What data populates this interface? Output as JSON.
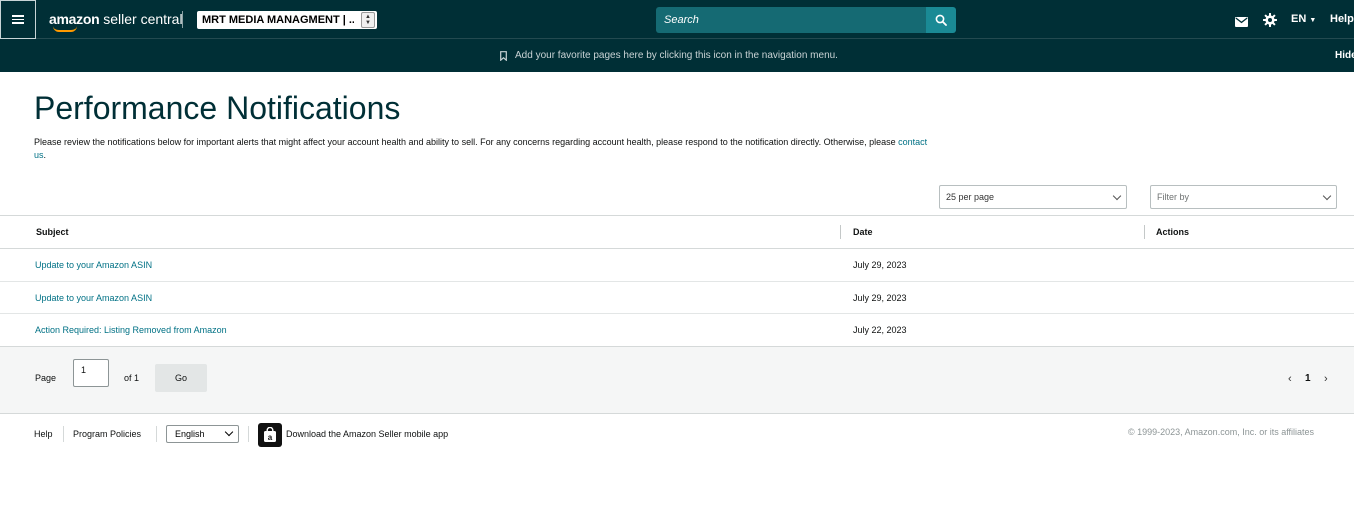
{
  "topbar": {
    "logo_brand": "amazon",
    "logo_sub": " seller central",
    "account": "MRT MEDIA MANAGMENT | ...",
    "search_placeholder": "Search",
    "language": "EN",
    "help": "Help"
  },
  "favorites_bar": {
    "message": "Add your favorite pages here by clicking this icon in the navigation menu.",
    "hide": "Hide"
  },
  "page": {
    "title": "Performance Notifications",
    "intro_text": "Please review the notifications below for important alerts that might affect your account health and ability to sell. For any concerns regarding account health, please respond to the notification directly. Otherwise, please ",
    "intro_link": "contact us",
    "intro_end": "."
  },
  "controls": {
    "per_page": "25 per page",
    "filter_placeholder": "Filter by"
  },
  "table": {
    "headers": {
      "subject": "Subject",
      "date": "Date",
      "actions": "Actions"
    },
    "rows": [
      {
        "subject": "Update to your Amazon ASIN",
        "date": "July 29, 2023"
      },
      {
        "subject": "Update to your Amazon ASIN",
        "date": "July 29, 2023"
      },
      {
        "subject": "Action Required: Listing Removed from Amazon",
        "date": "July 22, 2023"
      }
    ]
  },
  "pager": {
    "page_label": "Page",
    "page_value": "1",
    "of_label": "of 1",
    "go": "Go",
    "current": "1"
  },
  "footer": {
    "help": "Help",
    "program_policies": "Program Policies",
    "language": "English",
    "app_text": "Download the Amazon Seller mobile app",
    "copyright": "© 1999-2023, Amazon.com, Inc. or its affiliates"
  },
  "colors": {
    "nav_bg": "#002f36",
    "search_bg": "#156a73",
    "link": "#007185",
    "accent_orange": "#ff9900"
  },
  "icons": [
    "menu-icon",
    "search-icon",
    "mail-icon",
    "gear-icon",
    "bookmark-icon",
    "chevron-left-icon",
    "chevron-right-icon",
    "shopping-bag-icon"
  ]
}
